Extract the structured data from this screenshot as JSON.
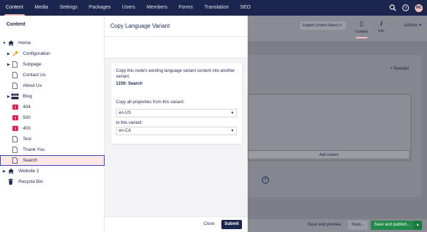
{
  "topnav": {
    "sections": [
      "Content",
      "Media",
      "Settings",
      "Packages",
      "Users",
      "Members",
      "Forms",
      "Translation",
      "SEO"
    ],
    "active": "Content",
    "user_initials": "MC",
    "icons": [
      "search-icon",
      "help-icon",
      "avatar"
    ]
  },
  "tree": {
    "title": "Content",
    "nodes": [
      {
        "label": "Home",
        "icon": "home-icon",
        "caret": "down"
      },
      {
        "label": "Configuration",
        "icon": "wrench-icon",
        "caret": "right"
      },
      {
        "label": "Subpage",
        "icon": "document-icon",
        "caret": "right"
      },
      {
        "label": "Contact Us",
        "icon": "document-icon"
      },
      {
        "label": "About Us",
        "icon": "document-icon"
      },
      {
        "label": "Blog",
        "icon": "blog-icon",
        "caret": "right"
      },
      {
        "label": "404",
        "icon": "error-page-icon"
      },
      {
        "label": "500",
        "icon": "error-page-icon"
      },
      {
        "label": "403",
        "icon": "error-page-icon"
      },
      {
        "label": "Test",
        "icon": "document-icon"
      },
      {
        "label": "Thank You",
        "icon": "document-icon"
      },
      {
        "label": "Search",
        "icon": "document-icon",
        "selected": true
      },
      {
        "label": "Website 2",
        "icon": "home-icon",
        "caret": "right"
      },
      {
        "label": "Recycle Bin",
        "icon": "trash-icon"
      }
    ]
  },
  "dialog": {
    "title": "Copy Language Variant",
    "description": "Copy this node's existing language variant content into another variant.",
    "node_label": "1230: Search",
    "from_label": "Copy all properties from this variant:",
    "from_value": "en-US",
    "to_label": "to this variant:",
    "to_value": "en-CA",
    "close_label": "Close",
    "submit_label": "Submit"
  },
  "background": {
    "language": "English (United States)",
    "apps": [
      {
        "label": "Content",
        "icon": "document-icon"
      },
      {
        "label": "Info",
        "icon": "info-icon"
      }
    ],
    "actions_label": "Actions",
    "reorder_label": "Reorder",
    "add_content_label": "Add content",
    "save_preview_label": "Save and preview",
    "save_label": "Save...",
    "publish_label": "Save and publish..."
  },
  "colors": {
    "nav_bg": "#1b264f",
    "accent": "#f5c1bc",
    "error_icon": "#d42054",
    "publish_green": "#1f8a4a"
  }
}
